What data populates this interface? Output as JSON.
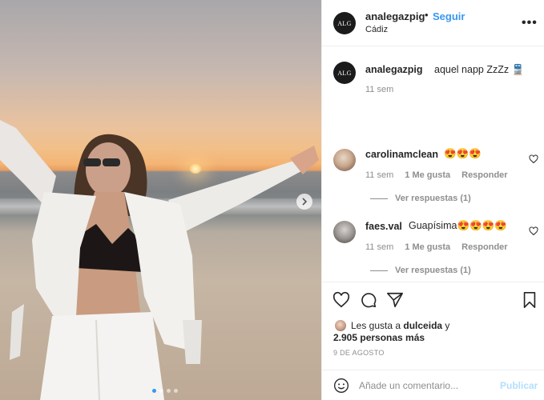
{
  "post": {
    "author_avatar_text": "ALG",
    "author": "analegazpig",
    "separator": "•",
    "follow_label": "Seguir",
    "location": "Cádiz",
    "more_icon": "more-horizontal-icon",
    "carousel": {
      "current_slide": 1,
      "total_slides": 4
    }
  },
  "caption": {
    "avatar_text": "ALG",
    "user": "analegazpig",
    "text": "aquel napp ZzZz 🚆",
    "time": "11 sem"
  },
  "comments": [
    {
      "user": "carolinamclean",
      "text": "😍😍😍",
      "time": "11 sem",
      "likes": "1 Me gusta",
      "reply_label": "Responder",
      "view_replies": "Ver respuestas (1)"
    },
    {
      "user": "faes.val",
      "text": "Guapísima😍😍😍😍",
      "time": "11 sem",
      "likes": "1 Me gusta",
      "reply_label": "Responder",
      "view_replies": "Ver respuestas (1)"
    }
  ],
  "likes": {
    "prefix": "Les gusta a ",
    "first_user": "dulceida",
    "connector": " y",
    "others": "2.905 personas más"
  },
  "date": "9 DE AGOSTO",
  "composer": {
    "placeholder": "Añade un comentario...",
    "publish_label": "Publicar"
  },
  "colors": {
    "link": "#3897f0",
    "muted": "#8e8e8e",
    "text": "#262626",
    "publish_disabled": "#b2dffc"
  }
}
